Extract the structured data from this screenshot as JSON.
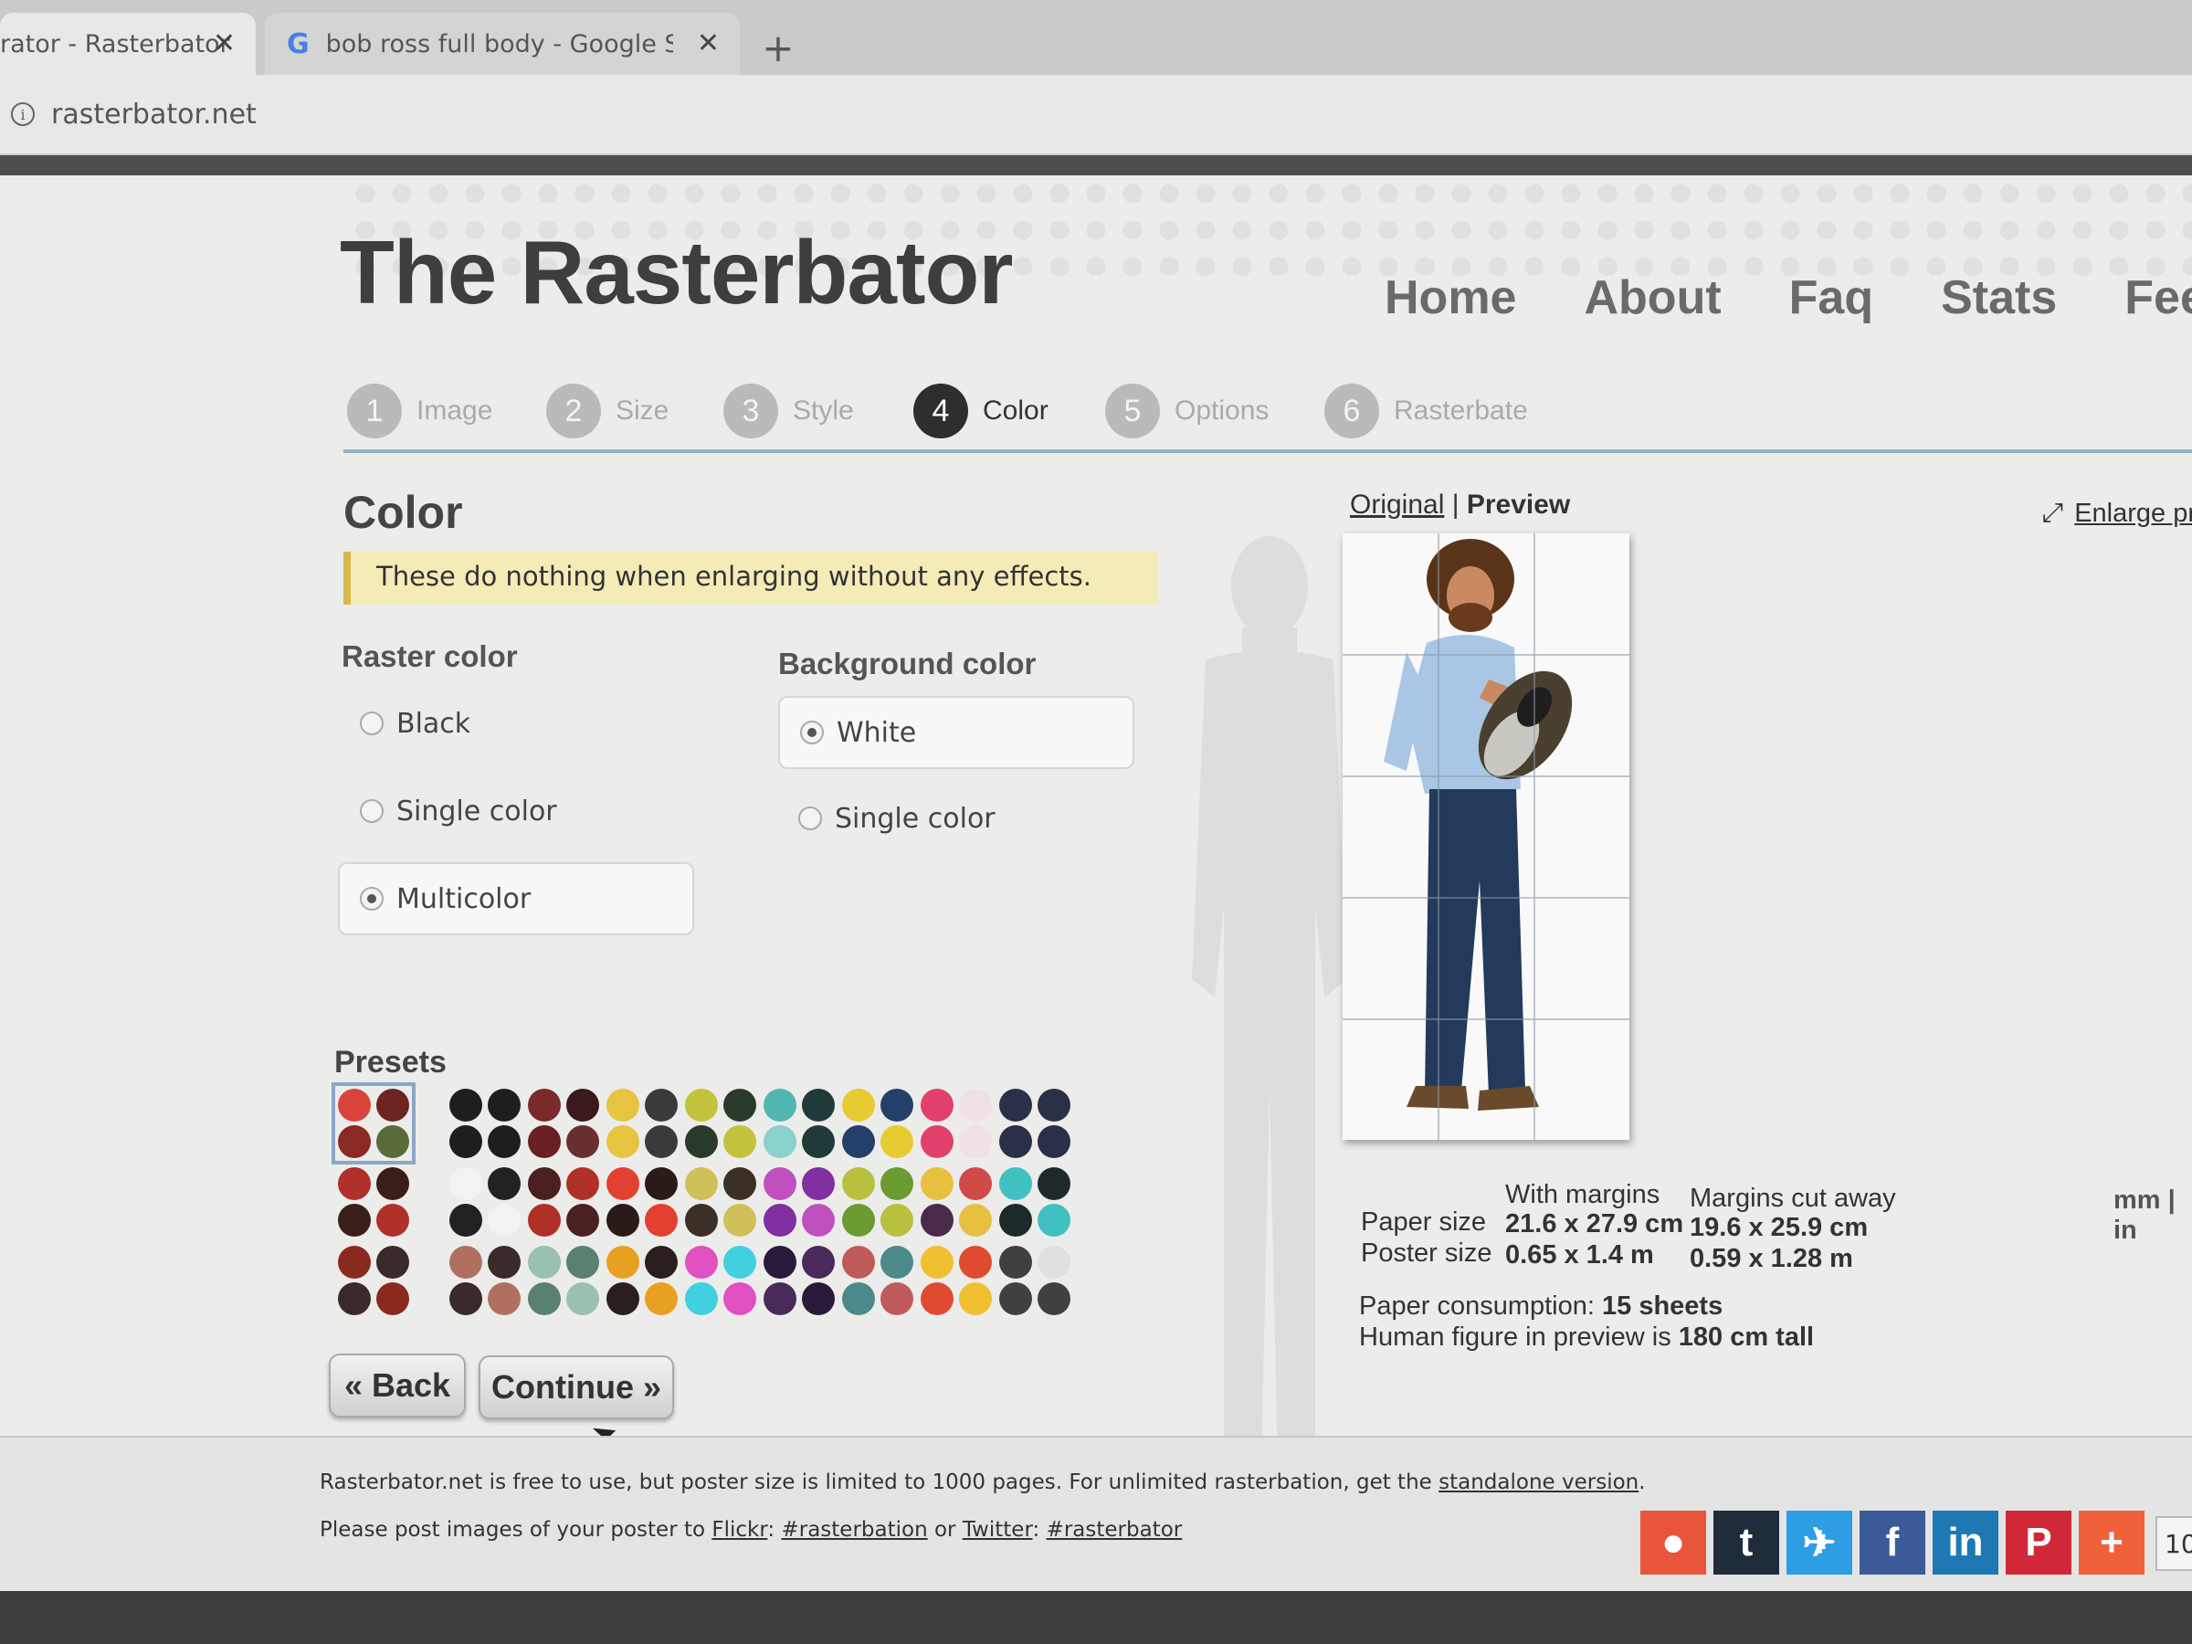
{
  "browser": {
    "tabs": [
      {
        "title": "rator - Rasterbator",
        "close": "✕"
      },
      {
        "title": "bob ross full body - Google Searc",
        "close": "✕",
        "icon": "G"
      }
    ],
    "new_tab": "+",
    "url": "rasterbator.net"
  },
  "site": {
    "logo": "The Rasterbator",
    "nav": [
      "Home",
      "About",
      "Faq",
      "Stats",
      "Feedb"
    ]
  },
  "steps": [
    {
      "num": "1",
      "label": "Image"
    },
    {
      "num": "2",
      "label": "Size"
    },
    {
      "num": "3",
      "label": "Style"
    },
    {
      "num": "4",
      "label": "Color"
    },
    {
      "num": "5",
      "label": "Options"
    },
    {
      "num": "6",
      "label": "Rasterbate"
    }
  ],
  "color_section": {
    "title": "Color",
    "notice": "These do nothing when enlarging without any effects.",
    "raster_title": "Raster color",
    "raster_options": [
      "Black",
      "Single color",
      "Multicolor"
    ],
    "raster_selected": "Multicolor",
    "bg_title": "Background color",
    "bg_options": [
      "White",
      "Single color"
    ],
    "bg_selected": "White",
    "presets_title": "Presets"
  },
  "presets_colors": [
    [
      "#d8443c",
      "#6b2420",
      "#8a2a22",
      "#5a6b3a"
    ],
    [
      "#1e1e1e",
      "#1e1e1e",
      "#1e1e1e",
      "#1e1e1e"
    ],
    [
      "#7a2a2a",
      "#3a1a1a",
      "#6a2020",
      "#6a3030"
    ],
    [
      "#e6c440",
      "#3a3a3a",
      "#e6c440",
      "#3a3a3a"
    ],
    [
      "#c2c23c",
      "#2a3a2a",
      "#2a3a2a",
      "#c2c23c"
    ],
    [
      "#52b6b0",
      "#203a3a",
      "#8ad0cc",
      "#203a3a"
    ],
    [
      "#e6cc30",
      "#24406a",
      "#24406a",
      "#e6cc30"
    ],
    [
      "#e2406c",
      "#f0e0e8",
      "#e2406c",
      "#f0e0e8"
    ],
    [
      "#2a3048",
      "#2a3048",
      "#2a3048",
      "#2a3048"
    ],
    [
      "#b0302a",
      "#3a1e1a",
      "#3a1e1a",
      "#b0302a"
    ],
    [
      "#f2f2f2",
      "#222222",
      "#222222",
      "#f2f2f2"
    ],
    [
      "#4a2020",
      "#b03028",
      "#b03028",
      "#4a2020"
    ],
    [
      "#e24030",
      "#2a1a18",
      "#2a1a18",
      "#e24030"
    ],
    [
      "#d0c05a",
      "#3a3028",
      "#3a3028",
      "#d0c05a"
    ],
    [
      "#c050c0",
      "#8030a0",
      "#8030a0",
      "#c050c0"
    ],
    [
      "#b8c040",
      "#6a9a30",
      "#6a9a30",
      "#b8c040"
    ],
    [
      "#e8c040",
      "#d04a4a",
      "#4a2a4a",
      "#e8c040"
    ],
    [
      "#40c0c0",
      "#1e2a2a",
      "#1e2a2a",
      "#40c0c0"
    ],
    [
      "#8a2a1e",
      "#3a2a2a",
      "#3a2a2a",
      "#8a2a1e"
    ],
    [
      "#b07060",
      "#3a2a2a",
      "#3a2a2a",
      "#b07060"
    ],
    [
      "#9ac0b0",
      "#5a8070",
      "#5a8070",
      "#9ac0b0"
    ],
    [
      "#e8a020",
      "#2a1e1e",
      "#2a1e1e",
      "#e8a020"
    ],
    [
      "#e050c0",
      "#40d0e0",
      "#40d0e0",
      "#e050c0"
    ],
    [
      "#2a1a3a",
      "#4a2a5a",
      "#4a2a5a",
      "#2a1a3a"
    ],
    [
      "#c05a5a",
      "#4a8a8a",
      "#4a8a8a",
      "#c05a5a"
    ],
    [
      "#f0c030",
      "#e04a30",
      "#e04a30",
      "#f0c030"
    ],
    [
      "#404040",
      "#e0e0e0",
      "#404040",
      "#404040"
    ]
  ],
  "buttons": {
    "back": "« Back",
    "continue": "Continue »"
  },
  "preview": {
    "original": "Original",
    "sep": "|",
    "preview": "Preview",
    "enlarge": "Enlarge pr",
    "hdr_with_margins": "With margins",
    "hdr_cut_away": "Margins cut away",
    "paper_label": "Paper size",
    "paper_with": "21.6 x 27.9 cm",
    "paper_cut": "19.6 x 25.9 cm",
    "poster_label": "Poster size",
    "poster_with": "0.65 x 1.4 m",
    "poster_cut": "0.59 x 1.28 m",
    "consumption_label": "Paper consumption:",
    "consumption_value": "15 sheets",
    "figure_label": "Human figure in preview is",
    "figure_value": "180 cm tall",
    "units": "mm | in"
  },
  "footer": {
    "line1_text": "Rasterbator.net is free to use, but poster size is limited to 1000 pages. For unlimited rasterbation, get the",
    "line1_link": "standalone version",
    "line1_end": ".",
    "line2_text": "Please post images of your poster to",
    "flickr": "Flickr",
    "flickr_tag": "#rasterbation",
    "or": "or",
    "twitter": "Twitter",
    "twitter_tag": "#rasterbator",
    "counter": "10"
  },
  "social": [
    {
      "name": "reddit-icon",
      "glyph": "●",
      "color": "#e8553a"
    },
    {
      "name": "tumblr-icon",
      "glyph": "t",
      "color": "#1f2c3a"
    },
    {
      "name": "twitter-icon",
      "glyph": "✈",
      "color": "#2d9ee3"
    },
    {
      "name": "facebook-icon",
      "glyph": "f",
      "color": "#3a5a98"
    },
    {
      "name": "linkedin-icon",
      "glyph": "in",
      "color": "#1e78b4"
    },
    {
      "name": "pinterest-icon",
      "glyph": "P",
      "color": "#d02838"
    },
    {
      "name": "more-icon",
      "glyph": "+",
      "color": "#f0603a"
    }
  ]
}
